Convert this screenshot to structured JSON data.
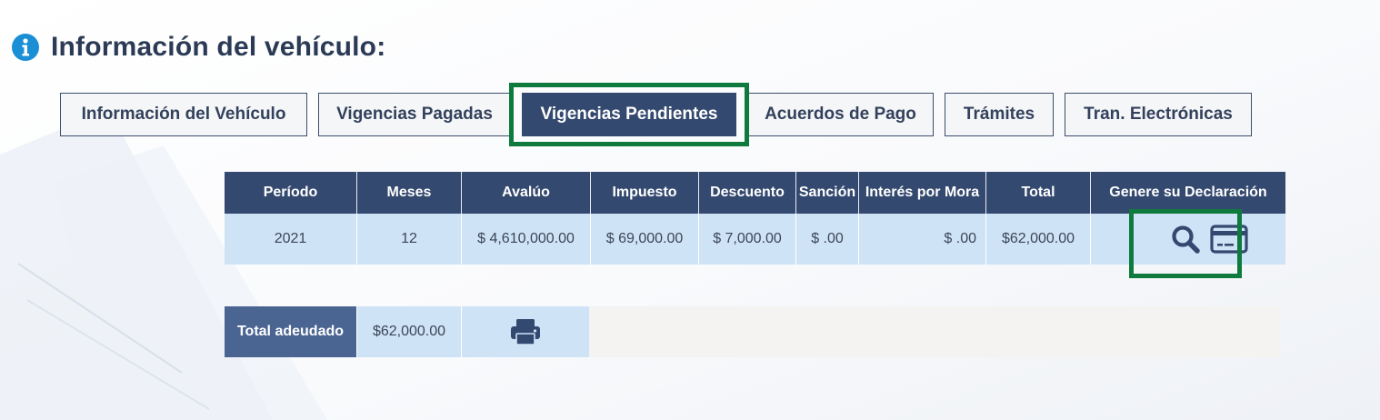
{
  "header": {
    "title": "Información del vehículo:",
    "icon": "info-circle-icon"
  },
  "tabs": [
    {
      "label": "Información del Vehículo",
      "active": false
    },
    {
      "label": "Vigencias Pagadas",
      "active": false
    },
    {
      "label": "Vigencias Pendientes",
      "active": true
    },
    {
      "label": "Acuerdos de Pago",
      "active": false
    },
    {
      "label": "Trámites",
      "active": false
    },
    {
      "label": "Tran. Electrónicas",
      "active": false
    }
  ],
  "table": {
    "headers": [
      "Período",
      "Meses",
      "Avalúo",
      "Impuesto",
      "Descuento",
      "Sanción",
      "Interés por Mora",
      "Total",
      "Genere su Declaración"
    ],
    "rows": [
      {
        "periodo": "2021",
        "meses": "12",
        "avaluo": "$ 4,610,000.00",
        "impuesto": "$ 69,000.00",
        "descuento": "$ 7,000.00",
        "sancion": "$ .00",
        "interes": "$ .00",
        "total": "$62,000.00",
        "actions": [
          "search-icon",
          "credit-card-icon"
        ]
      }
    ]
  },
  "summary": {
    "label": "Total adeudado",
    "value": "$62,000.00",
    "print_icon": "printer-icon"
  },
  "colors": {
    "primary": "#34496f",
    "row_bg": "#cfe3f7",
    "highlight": "#0e7a3d",
    "info": "#1a8fd6"
  }
}
